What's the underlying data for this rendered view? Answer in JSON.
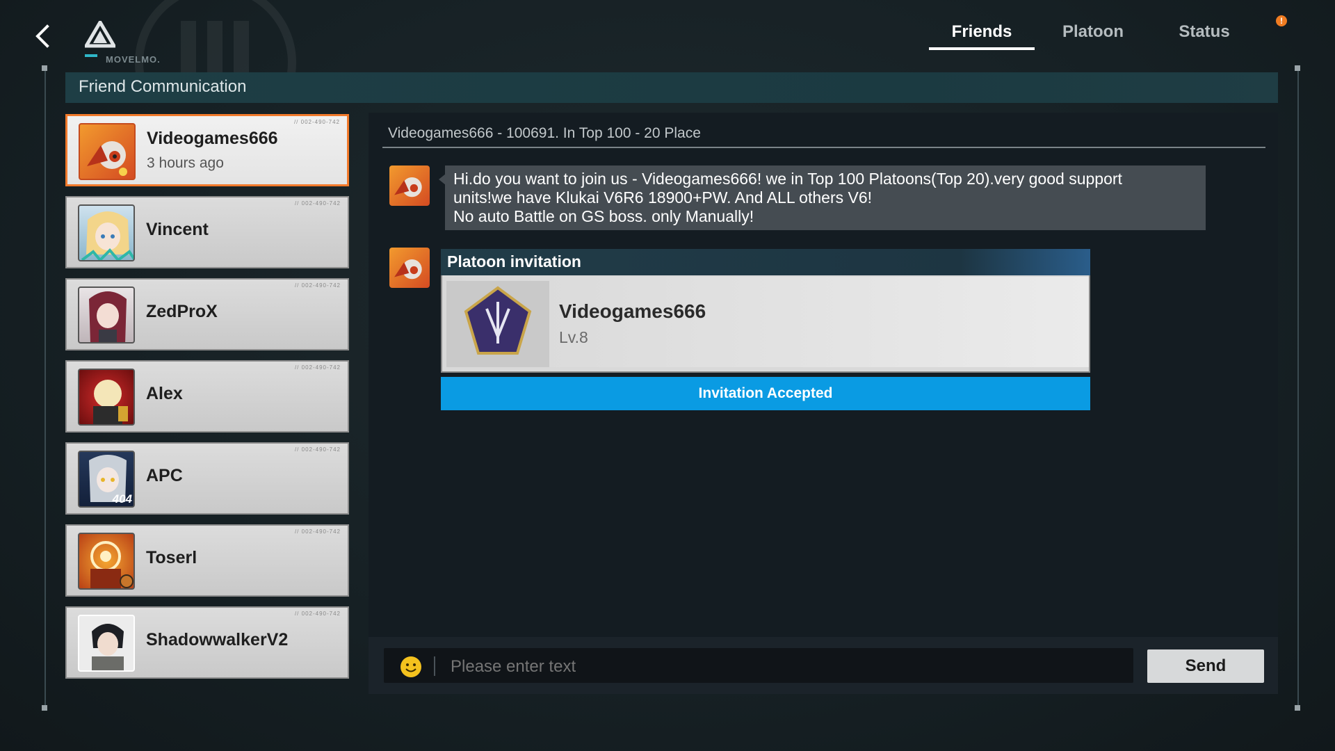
{
  "brand": {
    "logo_text": "MOVELMO."
  },
  "tabs": [
    {
      "label": "Friends",
      "active": true
    },
    {
      "label": "Platoon",
      "active": false
    },
    {
      "label": "Status",
      "active": false
    }
  ],
  "alert_badge": "!",
  "section_title": "Friend Communication",
  "friends": [
    {
      "name": "Videogames666",
      "sub": "3 hours ago",
      "selected": true,
      "avatar": "orange-mech-avatar"
    },
    {
      "name": "Vincent",
      "sub": "",
      "selected": false,
      "avatar": "blonde-girl-avatar"
    },
    {
      "name": "ZedProX",
      "sub": "",
      "selected": false,
      "avatar": "maroon-hair-girl-avatar"
    },
    {
      "name": "Alex",
      "sub": "",
      "selected": false,
      "avatar": "red-chibi-avatar"
    },
    {
      "name": "APC",
      "sub": "",
      "selected": false,
      "avatar": "silver-hair-404-avatar",
      "badge": "404"
    },
    {
      "name": "Toserl",
      "sub": "",
      "selected": false,
      "avatar": "orange-target-avatar"
    },
    {
      "name": "ShadowwalkerV2",
      "sub": "",
      "selected": false,
      "avatar": "dark-hair-boy-avatar"
    }
  ],
  "chat": {
    "header": "Videogames666 - 100691. In Top 100  - 20 Place",
    "message_lines": [
      "Hi.do you want to join us - Videogames666! we in Top 100 Platoons(Top 20).very good support",
      "units!we have Klukai V6R6 18900+PW. And ALL others V6!",
      "No auto Battle on GS boss. only Manually!"
    ],
    "invitation": {
      "title": "Platoon invitation",
      "name": "Videogames666",
      "level": "Lv.8",
      "button": "Invitation Accepted"
    }
  },
  "input": {
    "placeholder": "Please enter text",
    "send_label": "Send"
  },
  "colors": {
    "accent_orange": "#f27a2b",
    "accept_blue": "#0a9be3",
    "panel_bg": "#141c22"
  }
}
